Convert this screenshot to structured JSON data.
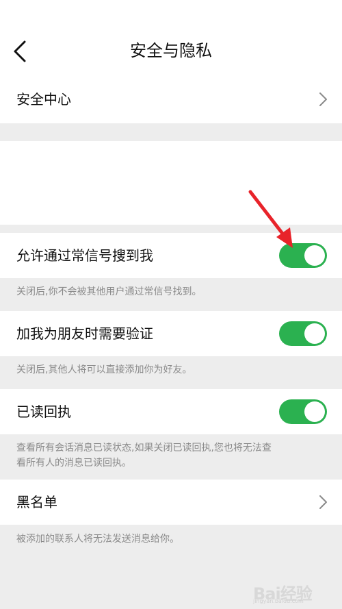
{
  "header": {
    "title": "安全与隐私"
  },
  "security_center": {
    "label": "安全中心"
  },
  "settings": [
    {
      "label": "允许通过常信号搜到我",
      "enabled": true,
      "description": "关闭后,你不会被其他用户通过常信号找到。"
    },
    {
      "label": "加我为朋友时需要验证",
      "enabled": true,
      "description": "关闭后,其他人将可以直接添加你为好友。"
    },
    {
      "label": "已读回执",
      "enabled": true,
      "description_line1": "查看所有会话消息已读状态,如果关闭已读回执,您也将无法查",
      "description_line2": "看所有人的消息已读回执。"
    }
  ],
  "blacklist": {
    "label": "黑名单",
    "description": "被添加的联系人将无法发送消息给你。"
  },
  "watermark": {
    "text": "Bai经验",
    "sub": "jingyan.baidu.com"
  },
  "colors": {
    "toggle_on": "#2bb150",
    "background": "#ededed",
    "arrow": "#e8232a"
  }
}
